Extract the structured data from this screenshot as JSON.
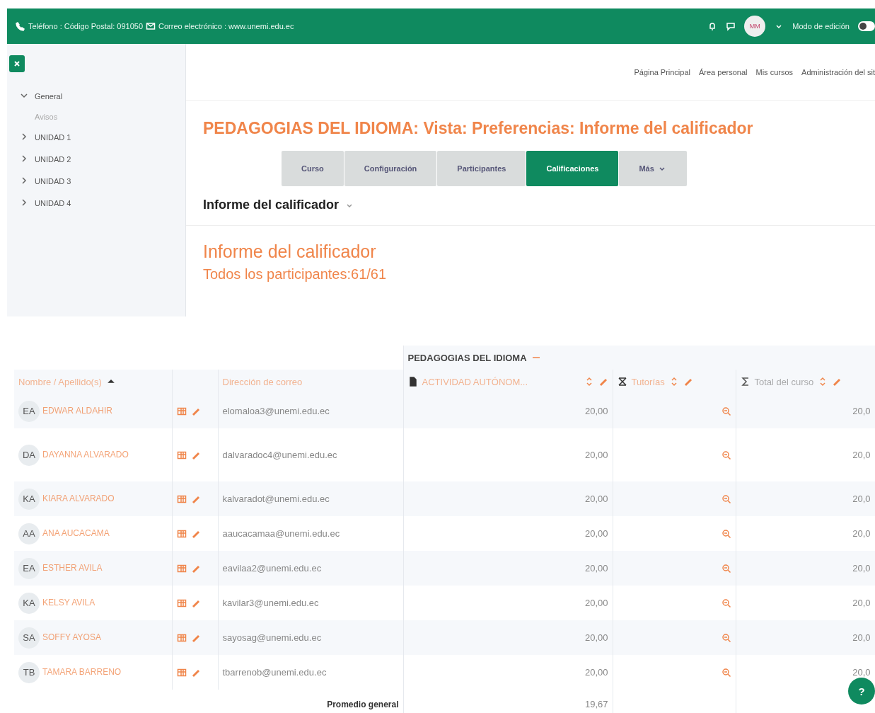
{
  "topbar": {
    "contact": [
      {
        "kind": "phone",
        "text": "Teléfono : Código Postal: 091050"
      },
      {
        "kind": "mail",
        "text": "Correo electrónico : www.unemi.edu.ec"
      }
    ],
    "avatar": "MM",
    "edit_mode": {
      "label": "Modo de edición",
      "on": false
    }
  },
  "navbar": [
    "Página Principal",
    "Área personal",
    "Mis cursos",
    "Administración del sit"
  ],
  "sidebar": {
    "items": [
      {
        "label": "General",
        "expanded": true,
        "children": [
          {
            "label": "Avisos"
          }
        ]
      },
      {
        "label": "UNIDAD 1",
        "expanded": false
      },
      {
        "label": "UNIDAD 2",
        "expanded": false
      },
      {
        "label": "UNIDAD 3",
        "expanded": false
      },
      {
        "label": "UNIDAD 4",
        "expanded": false
      }
    ]
  },
  "title": "PEDAGOGIAS DEL IDIOMA: Vista: Preferencias: Informe del calificador",
  "tabs": [
    {
      "label": "Curso",
      "selected": false
    },
    {
      "label": "Configuración",
      "selected": false
    },
    {
      "label": "Participantes",
      "selected": false
    },
    {
      "label": "Calificaciones",
      "selected": true
    },
    {
      "label": "Más",
      "selected": false
    }
  ],
  "report_selector": "Informe del calificador",
  "heading": "Informe del calificador",
  "participants": "Todos los participantes:61/61",
  "table": {
    "category": "PEDAGOGIAS DEL IDIOMA",
    "columns": [
      "Nombre / Apellido(s)",
      "Dirección de correo",
      "ACTIVIDAD AUTÓNOM...",
      "Tutorías",
      "Total del curso"
    ],
    "rows": [
      {
        "initials": "EA",
        "name": "EDWAR ALDAHIR",
        "email": "elomaloa3@unemi.edu.ec",
        "activity": "20,00",
        "total": "20,0"
      },
      {
        "initials": "DA",
        "name": "DAYANNA ALVARADO",
        "email": "dalvaradoc4@unemi.edu.ec",
        "activity": "20,00",
        "total": "20,0"
      },
      {
        "initials": "KA",
        "name": "KIARA ALVARADO",
        "email": "kalvaradot@unemi.edu.ec",
        "activity": "20,00",
        "total": "20,0"
      },
      {
        "initials": "AA",
        "name": "ANA AUCACAMA",
        "email": "aaucacamaa@unemi.edu.ec",
        "activity": "20,00",
        "total": "20,0"
      },
      {
        "initials": "EA",
        "name": "ESTHER AVILA",
        "email": "eavilaa2@unemi.edu.ec",
        "activity": "20,00",
        "total": "20,0"
      },
      {
        "initials": "KA",
        "name": "KELSY AVILA",
        "email": "kavilar3@unemi.edu.ec",
        "activity": "20,00",
        "total": "20,0"
      },
      {
        "initials": "SA",
        "name": "SOFFY AYOSA",
        "email": "sayosag@unemi.edu.ec",
        "activity": "20,00",
        "total": "20,0"
      },
      {
        "initials": "TB",
        "name": "TAMARA BARRENO",
        "email": "tbarrenob@unemi.edu.ec",
        "activity": "20,00",
        "total": "20,0"
      }
    ],
    "footer": {
      "label": "Promedio general",
      "activity": "19,67"
    }
  },
  "help": "?"
}
